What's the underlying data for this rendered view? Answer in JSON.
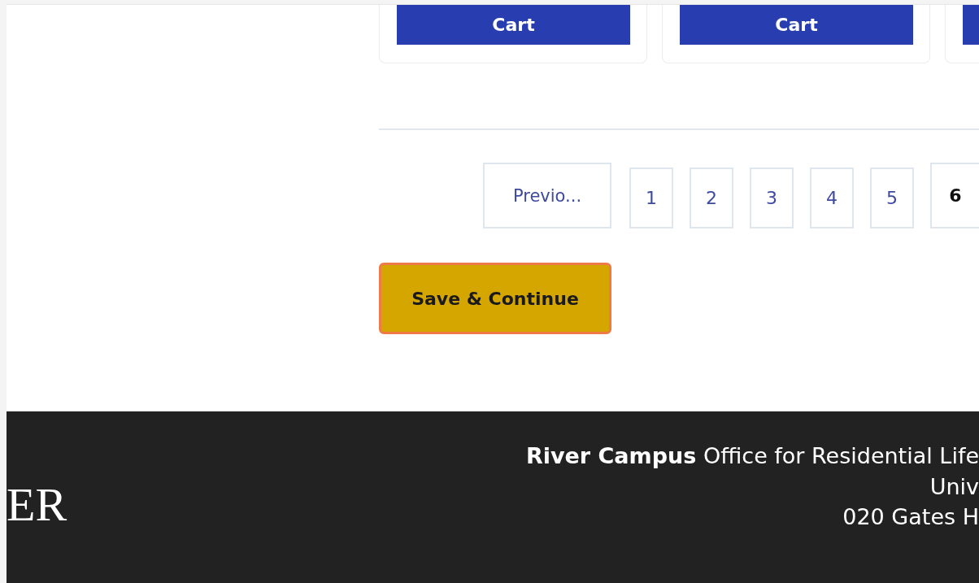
{
  "cards": [
    {
      "button_label": "Cart",
      "partial": false
    },
    {
      "button_label": "Cart",
      "partial": false
    },
    {
      "partial": true
    }
  ],
  "pagination": {
    "previous": "Previo...",
    "pages": [
      {
        "label": "1",
        "selected": false
      },
      {
        "label": "2",
        "selected": false
      },
      {
        "label": "3",
        "selected": false
      },
      {
        "label": "4",
        "selected": false
      },
      {
        "label": "5",
        "selected": false
      },
      {
        "label": "6",
        "selected": true
      }
    ]
  },
  "save_button": "Save & Continue",
  "footer": {
    "logo_text": "ER",
    "lines": [
      "**River Campus** Office for Residential Life",
      "Univ",
      "020 Gates H"
    ]
  }
}
